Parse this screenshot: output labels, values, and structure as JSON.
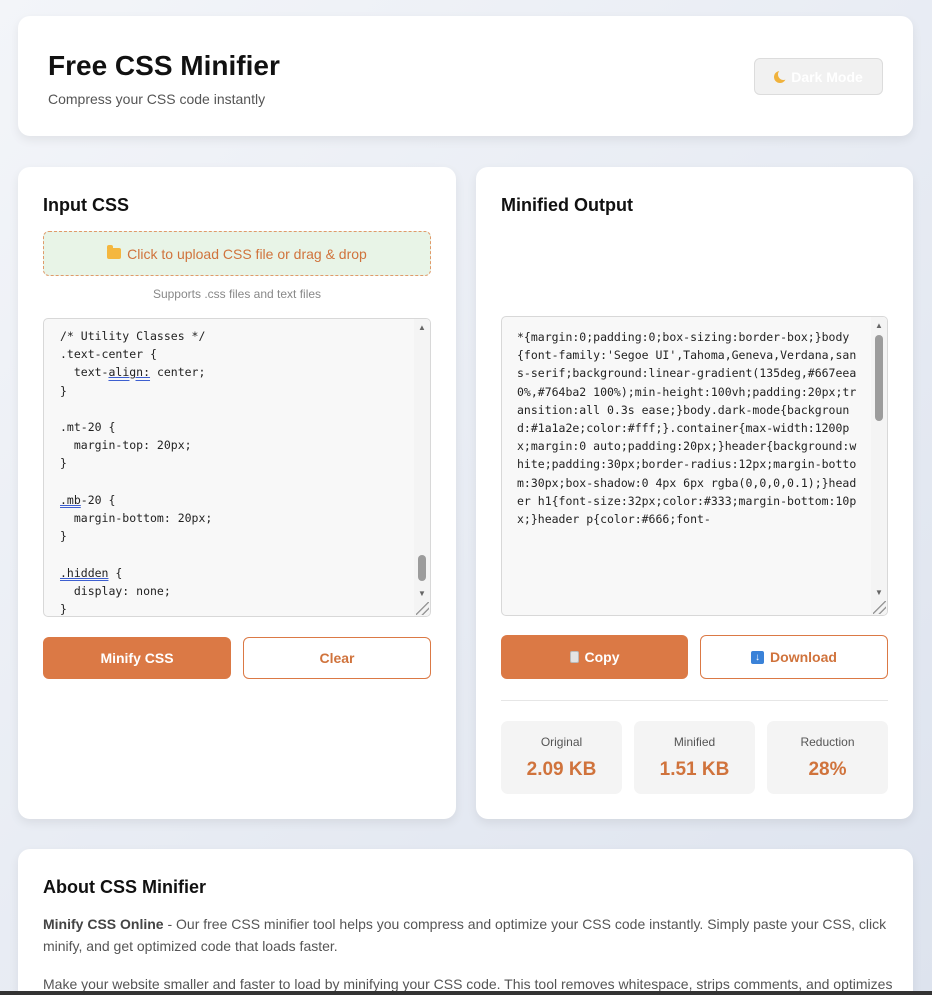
{
  "header": {
    "title": "Free CSS Minifier",
    "subtitle": "Compress your CSS code instantly",
    "dark_mode_label": "Dark Mode"
  },
  "input_panel": {
    "title": "Input CSS",
    "upload_label": "Click to upload CSS file or drag & drop",
    "supports_text": "Supports .css files and text files",
    "code_lines": [
      [
        "/* Utility Classes */"
      ],
      [
        ".text-center {"
      ],
      [
        "  text-",
        {
          "sq": "align:"
        },
        " center;"
      ],
      [
        "}"
      ],
      [
        ""
      ],
      [
        ".mt-20 {"
      ],
      [
        "  margin-top: 20px;"
      ],
      [
        "}"
      ],
      [
        ""
      ],
      [
        {
          "sq": ".mb"
        },
        "-20 {"
      ],
      [
        "  margin-bottom: 20px;"
      ],
      [
        "}"
      ],
      [
        ""
      ],
      [
        {
          "sq": ".hidden"
        },
        " {"
      ],
      [
        "  display: none;"
      ],
      [
        "}"
      ]
    ],
    "minify_label": "Minify CSS",
    "clear_label": "Clear"
  },
  "output_panel": {
    "title": "Minified Output",
    "code": "*{margin:0;padding:0;box-sizing:border-box;}body{font-family:'Segoe UI',Tahoma,Geneva,Verdana,sans-serif;background:linear-gradient(135deg,#667eea 0%,#764ba2 100%);min-height:100vh;padding:20px;transition:all 0.3s ease;}body.dark-mode{background:#1a1a2e;color:#fff;}.container{max-width:1200px;margin:0 auto;padding:20px;}header{background:white;padding:30px;border-radius:12px;margin-bottom:30px;box-shadow:0 4px 6px rgba(0,0,0,0.1);}header h1{font-size:32px;color:#333;margin-bottom:10px;}header p{color:#666;font-",
    "copy_label": "Copy",
    "download_label": "Download",
    "stats": [
      {
        "label": "Original",
        "value": "2.09 KB"
      },
      {
        "label": "Minified",
        "value": "1.51 KB"
      },
      {
        "label": "Reduction",
        "value": "28%"
      }
    ]
  },
  "about": {
    "title": "About CSS Minifier",
    "p1_strong": "Minify CSS Online",
    "p1_text": " - Our free CSS minifier tool helps you compress and optimize your CSS code instantly. Simply paste your CSS, click minify, and get optimized code that loads faster.",
    "p2_text": "Make your website smaller and faster to load by minifying your CSS code. This tool removes whitespace, strips comments, and optimizes"
  },
  "colors": {
    "accent": "#db7945",
    "upload_bg": "#e8f4e7",
    "stat_value": "#d0733c"
  },
  "icons": {
    "dark_mode": "moon-icon",
    "upload": "folder-icon",
    "copy": "clipboard-icon",
    "download": "download-arrow-icon"
  }
}
